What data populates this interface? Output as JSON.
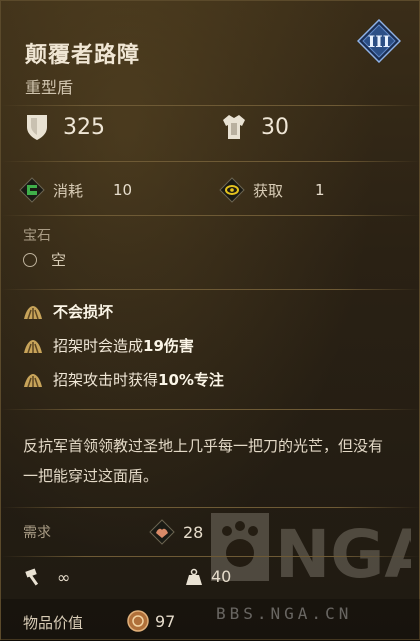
{
  "item": {
    "name": "颠覆者路障",
    "type": "重型盾",
    "tier": "III"
  },
  "stats": {
    "defense": "325",
    "weight": "30"
  },
  "costs": {
    "consume_label": "消耗",
    "consume_value": "10",
    "gain_label": "获取",
    "gain_value": "1"
  },
  "gems": {
    "header": "宝石",
    "slot_label": "空"
  },
  "perks": [
    {
      "text": "不会损坏",
      "bold": true
    },
    {
      "prefix": "招架时会造成",
      "highlight": "19伤害"
    },
    {
      "prefix": "招架攻击时获得",
      "highlight": "10%专注"
    }
  ],
  "lore": "反抗军首领领教过圣地上几乎每一把刀的光芒，但没有一把能穿过这面盾。",
  "requirements": {
    "header": "需求",
    "strength": "28",
    "durability": "∞",
    "weight_req": "40"
  },
  "price": {
    "label": "物品价值",
    "value": "97"
  },
  "watermark": {
    "logo_text": "NGA",
    "url": "BBS.NGA.CN"
  },
  "colors": {
    "tier_badge": "#2c4f86",
    "accent_gold": "#c8a45a"
  }
}
